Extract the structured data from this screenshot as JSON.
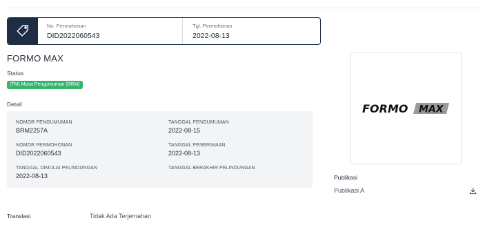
{
  "application": {
    "no_label": "No. Permohonan",
    "no_value": "DID2022060543",
    "date_label": "Tgl. Permohonan",
    "date_value": "2022-08-13",
    "icon": "tag-icon"
  },
  "mark": {
    "title": "FORMO MAX",
    "status_label": "Status",
    "status_badge": "(TM) Masa Pengumuman (BRM)",
    "status_color": "#34b36a",
    "logo_text_a": "FORMO",
    "logo_text_b": "MAX"
  },
  "detail": {
    "heading": "Detail",
    "fields": [
      {
        "label": "NOMOR PENGUMUMAN",
        "value": "BRM2257A"
      },
      {
        "label": "TANGGAL PENGUMUMAN",
        "value": "2022-08-15"
      },
      {
        "label": "NOMOR PERMOHONAN",
        "value": "DID2022060543"
      },
      {
        "label": "TANGGAL PENERIMAAN",
        "value": "2022-08-13"
      },
      {
        "label": "TANGGAL DIMULAI PELINDUNGAN",
        "value": "2022-08-13"
      },
      {
        "label": "TANGGAL BERAKHIR PELINDUNGAN",
        "value": ""
      }
    ]
  },
  "publication": {
    "heading": "Publikasi",
    "item": "Publikasi A",
    "download_icon": "download-icon"
  },
  "translation": {
    "label": "Translasi",
    "value": "Tidak Ada Terjemahan"
  },
  "colors": {
    "navy": "#1e2d44",
    "panel": "#f3f4f6"
  }
}
